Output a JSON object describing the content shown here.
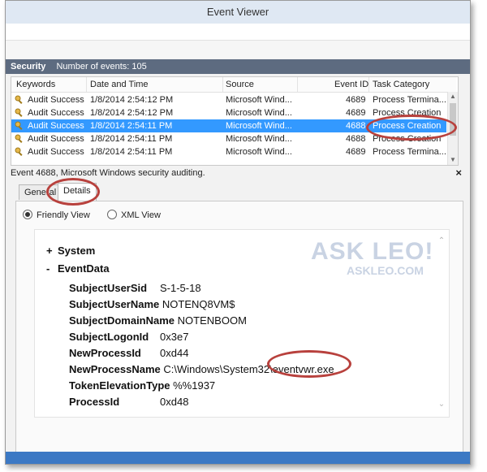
{
  "window": {
    "title": "Event Viewer"
  },
  "log": {
    "name": "Security",
    "count_text": "Number of events: 105"
  },
  "grid": {
    "columns": [
      "Keywords",
      "Date and Time",
      "Source",
      "Event ID",
      "Task Category"
    ],
    "rows": [
      {
        "keywords": "Audit Success",
        "datetime": "1/8/2014 2:54:12 PM",
        "source": "Microsoft Wind...",
        "event_id": "4689",
        "task": "Process Termina..."
      },
      {
        "keywords": "Audit Success",
        "datetime": "1/8/2014 2:54:12 PM",
        "source": "Microsoft Wind...",
        "event_id": "4689",
        "task": "Process Creation"
      },
      {
        "keywords": "Audit Success",
        "datetime": "1/8/2014 2:54:11 PM",
        "source": "Microsoft Wind...",
        "event_id": "4688",
        "task": "Process Creation"
      },
      {
        "keywords": "Audit Success",
        "datetime": "1/8/2014 2:54:11 PM",
        "source": "Microsoft Wind...",
        "event_id": "4688",
        "task": "Process Creation"
      },
      {
        "keywords": "Audit Success",
        "datetime": "1/8/2014 2:54:11 PM",
        "source": "Microsoft Wind...",
        "event_id": "4689",
        "task": "Process Termina..."
      }
    ]
  },
  "event": {
    "header": "Event 4688, Microsoft Windows security auditing.",
    "close": "×"
  },
  "tabs": {
    "general": "General",
    "details": "Details"
  },
  "views": {
    "friendly": "Friendly View",
    "xml": "XML View"
  },
  "details": {
    "system": {
      "sign": "+",
      "label": "System"
    },
    "eventdata": {
      "sign": "-",
      "label": "EventData"
    },
    "fields": [
      {
        "key": "SubjectUserSid",
        "value": "S-1-5-18"
      },
      {
        "key": "SubjectUserName",
        "value": "NOTENQ8VM$"
      },
      {
        "key": "SubjectDomainName",
        "value": "NOTENBOOM"
      },
      {
        "key": "SubjectLogonId",
        "value": "0x3e7"
      },
      {
        "key": "NewProcessId",
        "value": "0xd44"
      },
      {
        "key": "NewProcessName",
        "value": "C:\\Windows\\System32\\eventvwr.exe"
      },
      {
        "key": "TokenElevationType",
        "value": "%%1937"
      },
      {
        "key": "ProcessId",
        "value": "0xd48"
      }
    ]
  },
  "watermark": {
    "line1": "ASK LEO!",
    "line2": "ASKLEO.COM"
  },
  "colors": {
    "selection": "#3399ff",
    "annotation": "#b8413d",
    "header_bar": "#5d6b80"
  }
}
